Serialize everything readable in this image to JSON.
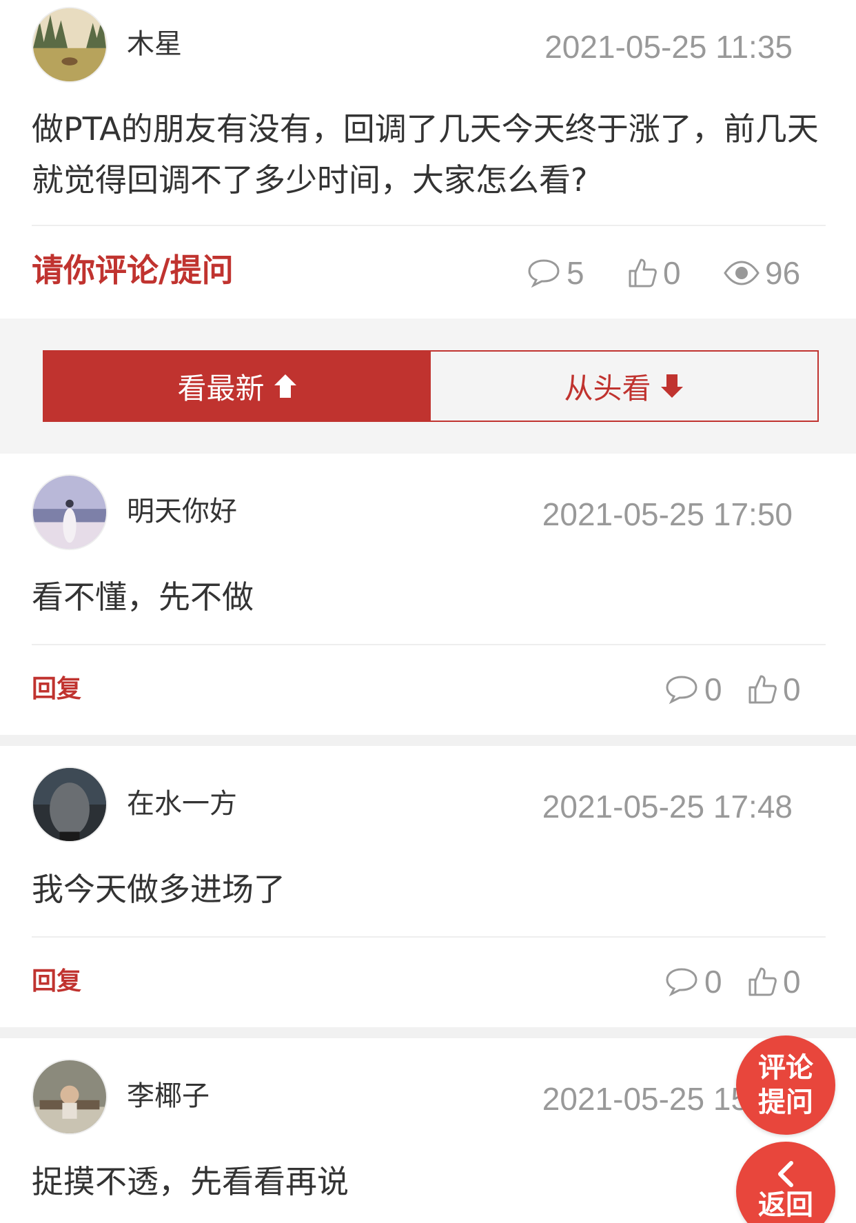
{
  "colors": {
    "accent": "#c0332f",
    "fab": "#e8463c",
    "muted": "#999999",
    "text": "#333333"
  },
  "post": {
    "author": "木星",
    "time": "2021-05-25 11:35",
    "text": "做PTA的朋友有没有，回调了几天今天终于涨了，前几天就觉得回调不了多少时间，大家怎么看?",
    "comment_cta": "请你评论/提问",
    "comments_count": "5",
    "likes_count": "0",
    "views_count": "96"
  },
  "sort": {
    "latest_label": "看最新",
    "from_start_label": "从头看"
  },
  "comments": [
    {
      "author": "明天你好",
      "time": "2021-05-25 17:50",
      "text": "看不懂，先不做",
      "reply_label": "回复",
      "replies": "0",
      "likes": "0"
    },
    {
      "author": "在水一方",
      "time": "2021-05-25 17:48",
      "text": "我今天做多进场了",
      "reply_label": "回复",
      "replies": "0",
      "likes": "0"
    },
    {
      "author": "李椰子",
      "time": "2021-05-25 15:09",
      "text": "捉摸不透，先看看再说"
    }
  ],
  "fab": {
    "comment_line1": "评论",
    "comment_line2": "提问",
    "back_label": "返回"
  },
  "icons": {
    "comment": "speech-bubble-icon",
    "like": "thumbs-up-icon",
    "views": "eye-icon",
    "up": "arrow-up-icon",
    "down": "arrow-down-icon",
    "back": "chevron-left-icon"
  }
}
